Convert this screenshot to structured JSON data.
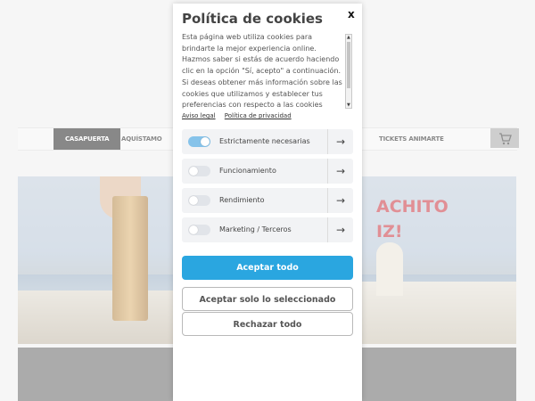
{
  "site": {
    "nav": [
      "CASAPUERTA",
      "AQUÍSTAMO",
      "TICKETS ANIMARTE"
    ],
    "hero_text_lines": [
      "ACHITO",
      "IZ!"
    ]
  },
  "cookie_modal": {
    "title": "Política de cookies",
    "close": "x",
    "description": "Esta página web utiliza cookies para brindarte la mejor experiencia online. Hazmos saber si estás de acuerdo haciendo clic en la opción \"Sí, acepto\" a continuación. Si deseas obtener más información sobre las cookies que utilizamos y establecer tus preferencias con respecto a las cookies",
    "links": {
      "legal": "Aviso legal",
      "privacy": "Política de privacidad"
    },
    "options": [
      {
        "label": "Estrictamente necesarias",
        "on": true
      },
      {
        "label": "Funcionamiento",
        "on": false
      },
      {
        "label": "Rendimiento",
        "on": false
      },
      {
        "label": "Marketing / Terceros",
        "on": false
      }
    ],
    "arrow": "→",
    "buttons": {
      "accept_all": "Aceptar todo",
      "accept_selected": "Aceptar solo lo seleccionado",
      "reject_all": "Rechazar todo"
    },
    "accent_color": "#2aa6e0"
  }
}
